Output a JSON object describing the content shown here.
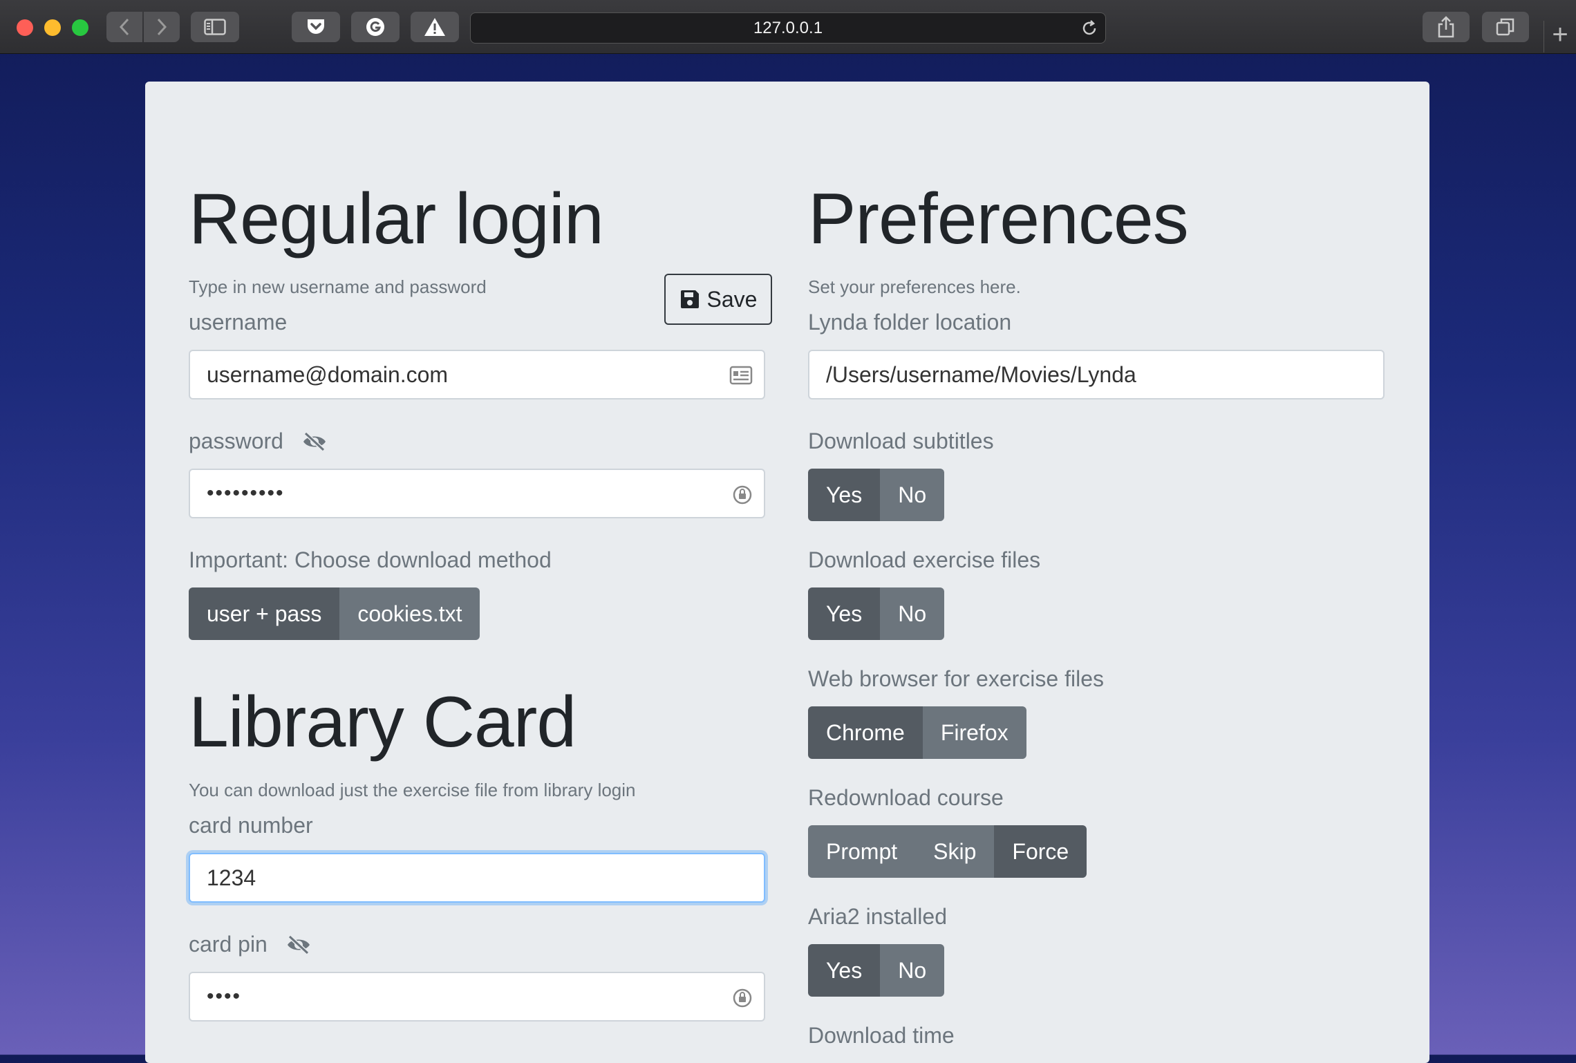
{
  "browser": {
    "address": "127.0.0.1"
  },
  "left": {
    "regular_login": {
      "title": "Regular login",
      "subtitle": "Type in new username and password",
      "save_label": "Save",
      "username_label": "username",
      "username_value": "username@domain.com",
      "password_label": "password",
      "password_value": "•••••••••",
      "method_label": "Important: Choose download method",
      "method_options": [
        "user + pass",
        "cookies.txt"
      ],
      "method_selected": "user + pass"
    },
    "library_card": {
      "title": "Library Card",
      "subtitle": "You can download just the exercise file from library login",
      "card_number_label": "card number",
      "card_number_value": "1234",
      "card_pin_label": "card pin",
      "card_pin_value": "••••"
    }
  },
  "right": {
    "title": "Preferences",
    "subtitle": "Set your preferences here.",
    "folder_label": "Lynda folder location",
    "folder_value": "/Users/username/Movies/Lynda",
    "subtitles_label": "Download subtitles",
    "subtitles_options": [
      "Yes",
      "No"
    ],
    "subtitles_selected": "Yes",
    "exercise_label": "Download exercise files",
    "exercise_options": [
      "Yes",
      "No"
    ],
    "exercise_selected": "Yes",
    "browser_label": "Web browser for exercise files",
    "browser_options": [
      "Chrome",
      "Firefox"
    ],
    "browser_selected": "Chrome",
    "redownload_label": "Redownload course",
    "redownload_options": [
      "Prompt",
      "Skip",
      "Force"
    ],
    "redownload_selected": "Force",
    "aria_label": "Aria2 installed",
    "aria_options": [
      "Yes",
      "No"
    ],
    "aria_selected": "Yes",
    "time_label": "Download time"
  }
}
